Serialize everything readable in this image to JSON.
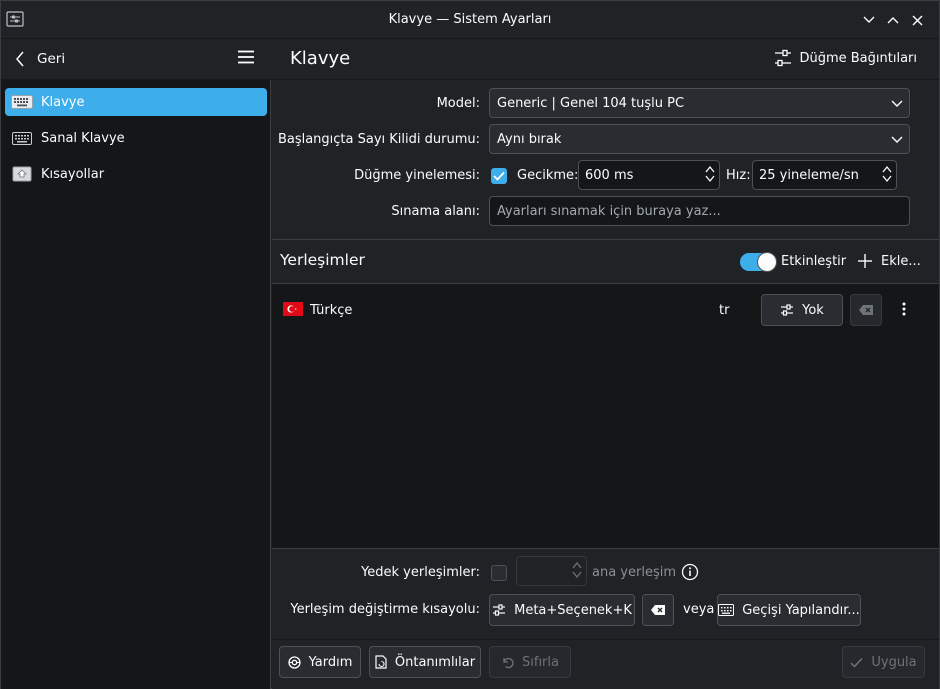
{
  "window": {
    "title": "Klavye — Sistem Ayarları"
  },
  "sidebar": {
    "back_label": "Geri",
    "items": [
      {
        "label": "Klavye",
        "icon": "keyboard-icon",
        "active": true
      },
      {
        "label": "Sanal Klavye",
        "icon": "virtual-keyboard-icon",
        "active": false
      },
      {
        "label": "Kısayollar",
        "icon": "shortcuts-icon",
        "active": false
      }
    ]
  },
  "main": {
    "title": "Klavye",
    "key_bindings_label": "Düğme Bağıntıları",
    "form": {
      "model_label": "Model:",
      "model_value": "Generic | Genel 104 tuşlu PC",
      "numlock_label": "Başlangıçta Sayı Kilidi durumu:",
      "numlock_value": "Aynı bırak",
      "repeat_label": "Düğme yinelemesi:",
      "repeat_checked": true,
      "delay_label": "Gecikme:",
      "delay_value": "600 ms",
      "rate_label": "Hız:",
      "rate_value": "25 yineleme/sn",
      "test_label": "Sınama alanı:",
      "test_placeholder": "Ayarları sınamak için buraya yaz..."
    },
    "layouts": {
      "title": "Yerleşimler",
      "enable_label": "Etkinleştir",
      "enabled": true,
      "add_label": "Ekle...",
      "rows": [
        {
          "name": "Türkçe",
          "code": "tr",
          "variant_label": "Yok",
          "flag": "turkey-flag"
        }
      ]
    },
    "spare": {
      "label": "Yedek yerleşimler:",
      "checked": false,
      "value": "",
      "suffix": "ana yerleşim"
    },
    "switch": {
      "label": "Yerleşim değiştirme kısayolu:",
      "shortcut": "Meta+Seçenek+K",
      "or_label": "veya",
      "configure_label": "Geçişi Yapılandır..."
    },
    "footer": {
      "help_label": "Yardım",
      "defaults_label": "Öntanımlılar",
      "reset_label": "Sıfırla",
      "apply_label": "Uygula"
    }
  },
  "colors": {
    "accent": "#3daee9",
    "background": "#202326",
    "view": "#141618"
  }
}
